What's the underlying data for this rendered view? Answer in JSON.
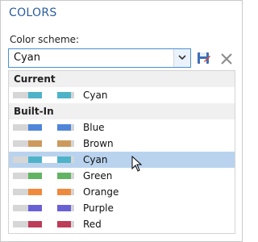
{
  "panel": {
    "title": "COLORS"
  },
  "scheme": {
    "label": "Color scheme:",
    "value": "Cyan",
    "save_icon": "save-icon",
    "delete_icon": "close-icon"
  },
  "groups": {
    "current": {
      "header": "Current",
      "items": [
        {
          "name": "Cyan"
        }
      ]
    },
    "builtin": {
      "header": "Built-In",
      "items": [
        {
          "name": "Blue",
          "color": "#4f86d9"
        },
        {
          "name": "Brown",
          "color": "#cc9a5e"
        },
        {
          "name": "Cyan",
          "color": "#4fb3c8",
          "selected": true
        },
        {
          "name": "Green",
          "color": "#62b462"
        },
        {
          "name": "Orange",
          "color": "#ef8a3c"
        },
        {
          "name": "Purple",
          "color": "#6a60d6"
        },
        {
          "name": "Red",
          "color": "#bd3c58"
        }
      ]
    }
  },
  "colors": {
    "accent": "#2a5d9f",
    "selection": "#b9d3ee",
    "swatch_light": "#d6d6d6"
  }
}
